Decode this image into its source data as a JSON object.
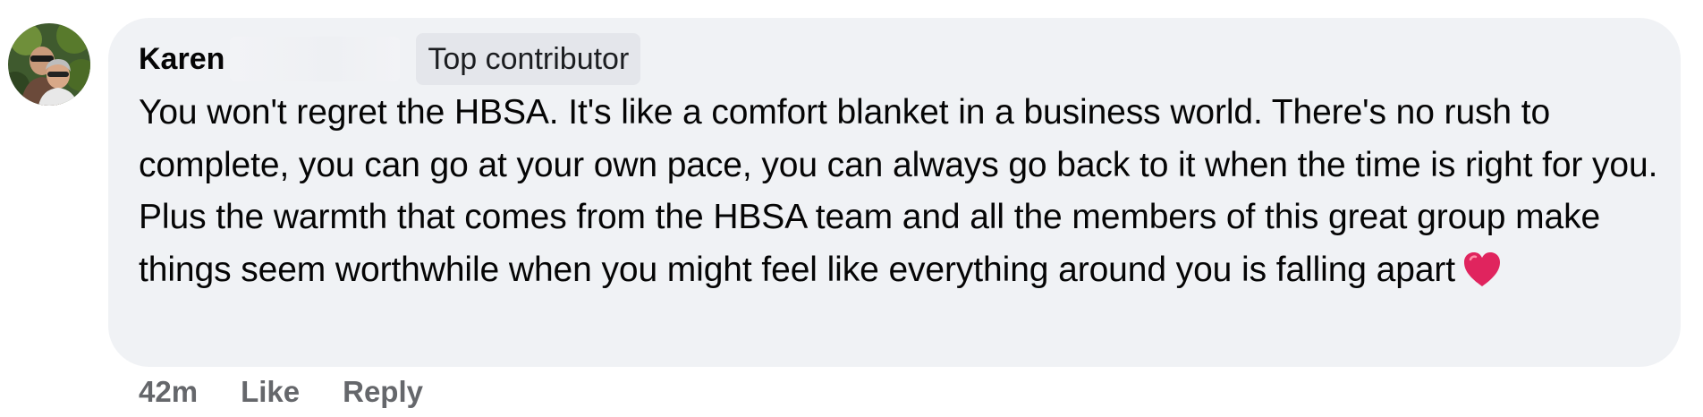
{
  "comment": {
    "author": "Karen",
    "badge": "Top contributor",
    "text": "You won't regret the HBSA. It's like a comfort blanket in a business world. There's no rush to complete, you can go at your own pace, you can always go back to it when the time is right for you. Plus the warmth that comes from the HBSA team and all the members of this great group make things seem worthwhile when you might feel like everything around you is falling apart",
    "emoji_icon": "red-heart-icon",
    "avatar_icon": "profile-photo"
  },
  "actions": {
    "timestamp": "42m",
    "like_label": "Like",
    "reply_label": "Reply"
  },
  "colors": {
    "bubble_bg": "#f0f2f5",
    "badge_bg": "#e4e6eb",
    "text": "#050505",
    "secondary_text": "#65676b",
    "heart": "#e0245e"
  }
}
